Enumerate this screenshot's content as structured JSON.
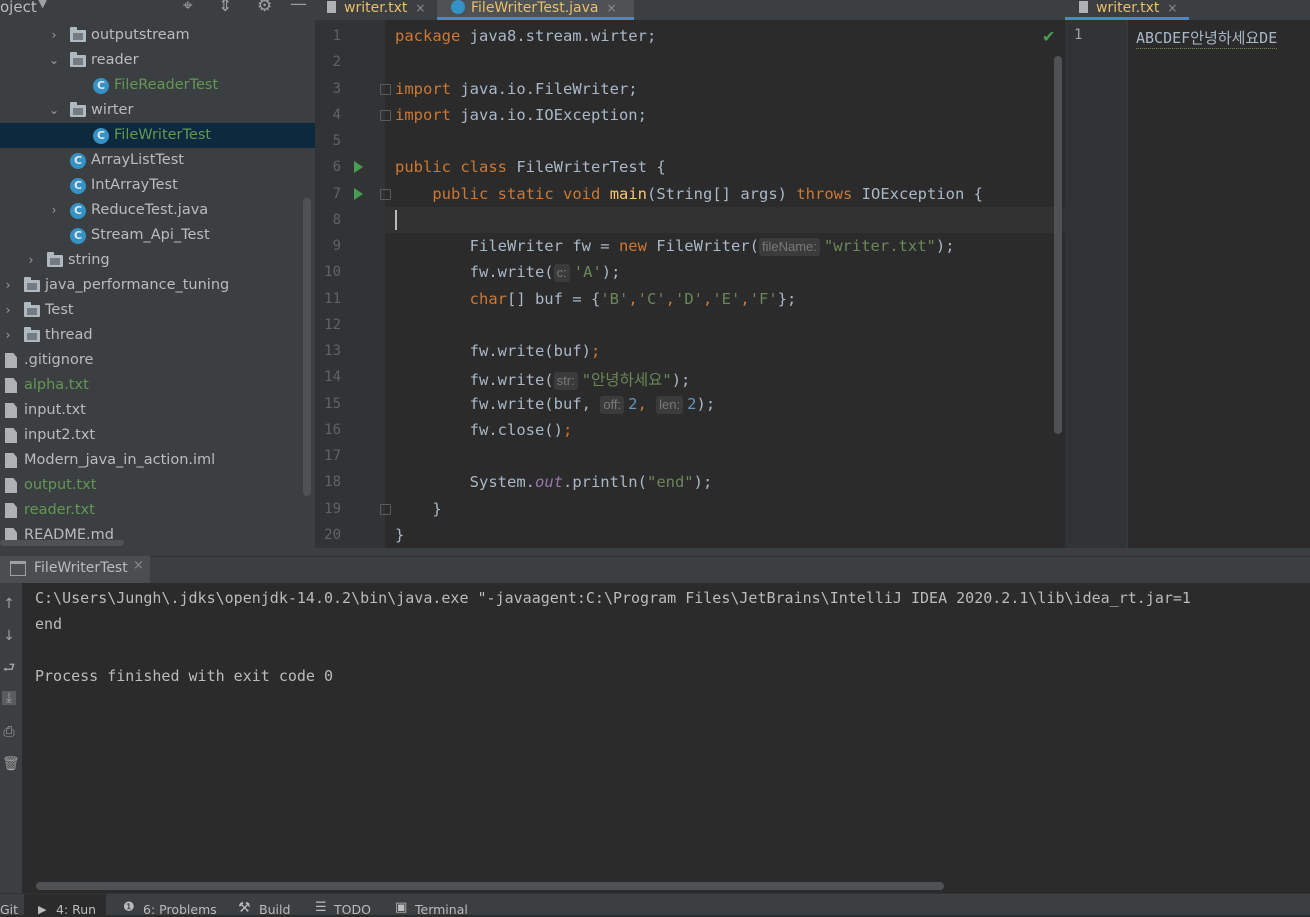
{
  "project": {
    "title": "oject",
    "items": [
      {
        "label": "outputstream",
        "kind": "folder",
        "arrow": "›"
      },
      {
        "label": "reader",
        "kind": "folder",
        "arrow": "⌄"
      },
      {
        "label": "FileReaderTest",
        "kind": "class"
      },
      {
        "label": "wirter",
        "kind": "folder",
        "arrow": "⌄"
      },
      {
        "label": "FileWriterTest",
        "kind": "class"
      },
      {
        "label": "ArrayListTest",
        "kind": "class"
      },
      {
        "label": "IntArrayTest",
        "kind": "class"
      },
      {
        "label": "ReduceTest.java",
        "kind": "class",
        "arrow": "›"
      },
      {
        "label": "Stream_Api_Test",
        "kind": "class"
      },
      {
        "label": "string",
        "kind": "folder",
        "arrow": "›"
      },
      {
        "label": "java_performance_tuning",
        "kind": "folder",
        "arrow": "›"
      },
      {
        "label": "Test",
        "kind": "folder",
        "arrow": "›"
      },
      {
        "label": "thread",
        "kind": "folder",
        "arrow": "›"
      },
      {
        "label": ".gitignore",
        "kind": "file"
      },
      {
        "label": "alpha.txt",
        "kind": "file"
      },
      {
        "label": "input.txt",
        "kind": "file"
      },
      {
        "label": "input2.txt",
        "kind": "file"
      },
      {
        "label": "Modern_java_in_action.iml",
        "kind": "file"
      },
      {
        "label": "output.txt",
        "kind": "file"
      },
      {
        "label": "reader.txt",
        "kind": "file"
      },
      {
        "label": "README.md",
        "kind": "file"
      }
    ],
    "c_glyph": "C"
  },
  "tabs": {
    "left": [
      {
        "label": "writer.txt"
      },
      {
        "label": "FileWriterTest.java"
      }
    ],
    "right": [
      {
        "label": "writer.txt"
      }
    ],
    "close": "×"
  },
  "editor": {
    "line_numbers": [
      "1",
      "2",
      "3",
      "4",
      "5",
      "6",
      "7",
      "8",
      "9",
      "10",
      "11",
      "12",
      "13",
      "14",
      "15",
      "16",
      "17",
      "18",
      "19",
      "20"
    ],
    "line1": {
      "kw": "package",
      "rest": " java8.stream.wirter;"
    },
    "line3": {
      "kw": "import",
      "rest": " java.io.FileWriter;"
    },
    "line4": {
      "kw": "import",
      "rest": " java.io.IOException;"
    },
    "line6": {
      "kw1": "public",
      "kw2": "class",
      "name": " FileWriterTest {"
    },
    "line7": {
      "kw1": "public",
      "kw2": "static",
      "kw3": "void",
      "fn": "main",
      "mid": "(String[] args) ",
      "kw4": "throws",
      "rest": " IOException {"
    },
    "line9": {
      "a": "FileWriter fw = ",
      "kw": "new",
      "b": " FileWriter(",
      "hint": "fileName:",
      "str": "\"writer.txt\"",
      "c": ");"
    },
    "line10": {
      "a": "fw.write(",
      "hint": "c:",
      "str": "'A'",
      "c": ");"
    },
    "line11": {
      "kw": "char",
      "a": "[] buf = {",
      "s1": "'B'",
      "s2": "'C'",
      "s3": "'D'",
      "s4": "'E'",
      "s5": "'F'",
      "c": "};"
    },
    "line13": {
      "a": "fw.write(buf)",
      "c": ";"
    },
    "line14": {
      "a": "fw.write(",
      "hint": "str:",
      "str": "\"안녕하세요\"",
      "c": ");"
    },
    "line15": {
      "a": "fw.write(buf, ",
      "hint1": "off:",
      "n1": "2",
      "hint2": "len:",
      "n2": "2",
      "c": ");"
    },
    "line16": {
      "a": "fw.close()",
      "c": ";"
    },
    "line18": {
      "a": "System.",
      "out": "out",
      "b": ".println(",
      "str": "\"end\"",
      "c": ");"
    },
    "line19": {
      "a": "}"
    },
    "line20": {
      "a": "}"
    },
    "check": "✔"
  },
  "right_editor": {
    "line": "1",
    "text": "ABCDEF안녕하세요DE"
  },
  "run": {
    "tab_label": "FileWriterTest",
    "lines": [
      "C:\\Users\\Jungh\\.jdks\\openjdk-14.0.2\\bin\\java.exe \"-javaagent:C:\\Program Files\\JetBrains\\IntelliJ IDEA 2020.2.1\\lib\\idea_rt.jar=1",
      "end",
      "",
      "Process finished with exit code 0"
    ]
  },
  "statusbar": {
    "git": "Git",
    "run": "4: Run",
    "problems": "6: Problems",
    "build": "Build",
    "todo": "TODO",
    "terminal": "Terminal"
  },
  "colors": {
    "accent": "#4a88c7",
    "keyword": "#cc7832",
    "string": "#6a8759",
    "green": "#629755"
  }
}
